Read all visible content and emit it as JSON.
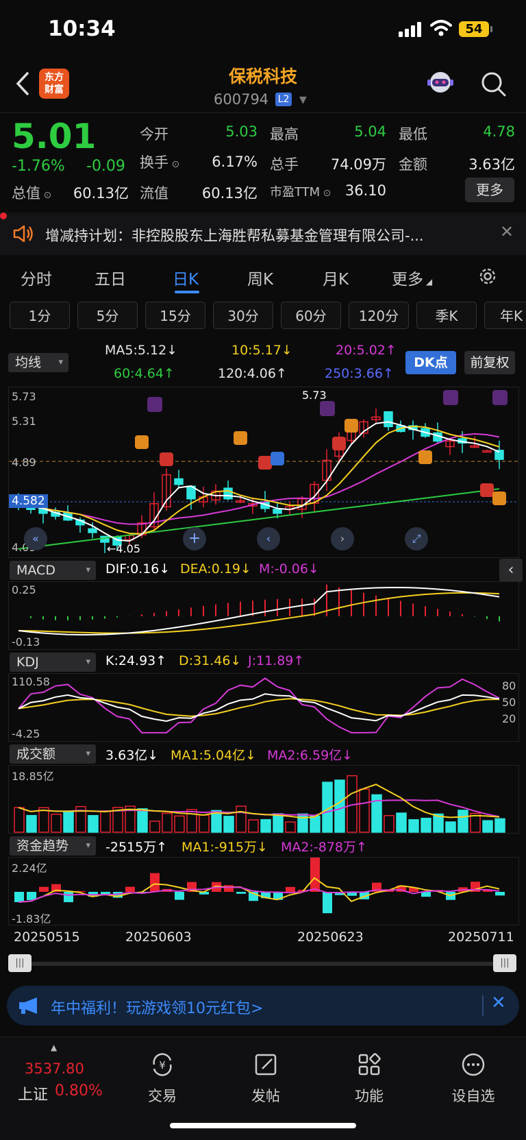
{
  "status": {
    "time": "10:34",
    "battery": "54"
  },
  "header": {
    "back_icon": "chevron-left-icon",
    "logo_text": "东方财富",
    "stock_name": "保税科技",
    "stock_code": "600794",
    "level_badge": "L2"
  },
  "quote": {
    "price": "5.01",
    "change_pct": "-1.76%",
    "change_abs": "-0.09",
    "colors": {
      "up": "#e8232f",
      "down": "#2ecc40"
    },
    "fields": [
      {
        "label": "今开",
        "value": "5.03"
      },
      {
        "label": "最高",
        "value": "5.04"
      },
      {
        "label": "最低",
        "value": "4.78"
      },
      {
        "label": "换手",
        "value": "6.17%"
      },
      {
        "label": "总手",
        "value": "74.09万"
      },
      {
        "label": "金额",
        "value": "3.63亿"
      },
      {
        "label": "总值",
        "value": "60.13亿"
      },
      {
        "label": "流值",
        "value": "60.13亿"
      },
      {
        "label": "市盈TTM",
        "value": "36.10"
      }
    ],
    "more_button": "更多"
  },
  "notice": {
    "text": "增减持计划：非控股股东上海胜帮私募基金管理有限公司-..."
  },
  "tabs": [
    {
      "label": "分时"
    },
    {
      "label": "五日"
    },
    {
      "label": "日K",
      "active": true
    },
    {
      "label": "周K"
    },
    {
      "label": "月K"
    },
    {
      "label": "更多"
    }
  ],
  "periods": [
    "1分",
    "5分",
    "15分",
    "30分",
    "60分",
    "120分",
    "季K",
    "年K"
  ],
  "ma": {
    "selector": "均线",
    "items": [
      {
        "text": "MA5:5.12↓",
        "color": "#e6e6e6"
      },
      {
        "text": "10:5.17↓",
        "color": "#f5d020"
      },
      {
        "text": "20:5.02↑",
        "color": "#d63ad6"
      },
      {
        "text": "60:4.64↑",
        "color": "#2ecc40"
      },
      {
        "text": "120:4.06↑",
        "color": "#e6e6e6"
      },
      {
        "text": "250:3.66↑",
        "color": "#5b6cff"
      }
    ],
    "dk_button": "DK点",
    "fq_button": "前复权"
  },
  "kline": {
    "y_top": "5.73",
    "y_2": "5.31",
    "y_3": "4.89",
    "y_current": "4.582",
    "y_bottom": "4.05",
    "high_label": "5.73",
    "low_label": "←4.05"
  },
  "macd": {
    "selector": "MACD",
    "dif": "DIF:0.16↓",
    "dea": "DEA:0.19↓",
    "m": "M:-0.06↓",
    "y_top": "0.25",
    "y_bottom": "-0.13"
  },
  "kdj": {
    "selector": "KDJ",
    "k": "K:24.93↑",
    "d": "D:31.46↓",
    "j": "J:11.89↑",
    "y_top": "110.58",
    "y_bottom": "-4.25",
    "r80": "80",
    "r50": "50",
    "r20": "20"
  },
  "amount": {
    "selector": "成交额",
    "val": "3.63亿↓",
    "ma1": "MA1:5.04亿↓",
    "ma2": "MA2:6.59亿↓",
    "y_top": "18.85亿"
  },
  "fund": {
    "selector": "资金趋势",
    "val": "-2515万↑",
    "ma1": "MA1:-915万↓",
    "ma2": "MA2:-878万↑",
    "y_top": "2.24亿",
    "y_bottom": "-1.83亿"
  },
  "dates": [
    "20250515",
    "20250603",
    "20250623",
    "20250711"
  ],
  "promo": {
    "text": "年中福利！玩游戏领10元红包>"
  },
  "bottom": {
    "index_value": "3537.80",
    "index_name": "上证",
    "index_pct": "0.80%",
    "nav": [
      {
        "label": "交易",
        "icon": "yuan-exchange-icon"
      },
      {
        "label": "发帖",
        "icon": "edit-post-icon"
      },
      {
        "label": "功能",
        "icon": "grid-apps-icon"
      },
      {
        "label": "设自选",
        "icon": "more-dots-icon"
      }
    ]
  }
}
